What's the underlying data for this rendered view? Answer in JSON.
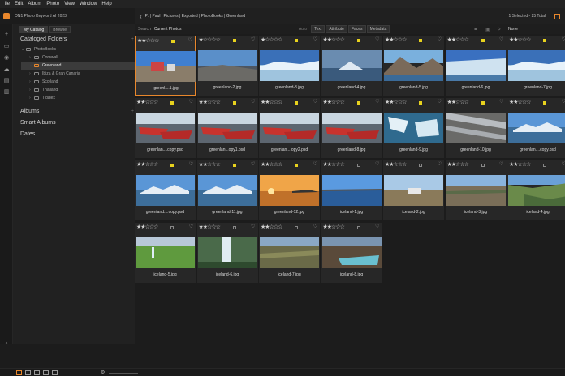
{
  "menu": [
    "ile",
    "Edit",
    "Album",
    "Photo",
    "View",
    "Window",
    "Help"
  ],
  "app_title": "ON1 Photo Keyword AI 2023",
  "sidebar": {
    "tabs": [
      "My Catalog",
      "Browse"
    ],
    "cataloged_folders": "Cataloged Folders",
    "tree": [
      {
        "label": "PhotoBooks",
        "level": 0,
        "open": true
      },
      {
        "label": "Cornwall",
        "level": 1
      },
      {
        "label": "Greenland",
        "level": 1,
        "selected": true,
        "open": true
      },
      {
        "label": "Ibiza & Gran Canaria",
        "level": 1
      },
      {
        "label": "Scotland",
        "level": 1
      },
      {
        "label": "Thailand",
        "level": 1
      },
      {
        "label": "Tidalex",
        "level": 1
      }
    ],
    "albums": "Albums",
    "smart_albums": "Smart Albums",
    "dates": "Dates"
  },
  "toolbar": {
    "breadcrumb": "P: | Paul | Pictures | Exported | PhotoBooks | Greenland",
    "status": "1 Selected - 25 Total"
  },
  "filter": {
    "search_label": "Search",
    "search_value": "Current Photos",
    "auto": "Auto",
    "tabs": [
      "Text",
      "Attribute",
      "Faces",
      "Metadata"
    ],
    "sort_value": "None"
  },
  "photos": [
    {
      "name": "greenl....1.jpg",
      "stars": 2,
      "flag": "yellow",
      "scene": "port",
      "selected": true
    },
    {
      "name": "greenland-2.jpg",
      "stars": 1,
      "flag": "yellow",
      "scene": "coast"
    },
    {
      "name": "greenland-3.jpg",
      "stars": 1,
      "flag": "yellow",
      "scene": "ice"
    },
    {
      "name": "greenland-4.jpg",
      "stars": 2,
      "flag": "yellow",
      "scene": "berg"
    },
    {
      "name": "greenland-5.jpg",
      "stars": 2,
      "flag": "yellow",
      "scene": "mount"
    },
    {
      "name": "greenland-6.jpg",
      "stars": 2,
      "flag": "yellow",
      "scene": "glacier"
    },
    {
      "name": "greenland-7.jpg",
      "stars": 2,
      "flag": "yellow",
      "scene": "ice"
    },
    {
      "name": "greenlan....copy.psd",
      "stars": 2,
      "flag": "yellow",
      "scene": "boats"
    },
    {
      "name": "greenlan...opy1.psd",
      "stars": 2,
      "flag": "yellow",
      "scene": "boats"
    },
    {
      "name": "greenlan....opy2.psd",
      "stars": 2,
      "flag": "yellow",
      "scene": "boats"
    },
    {
      "name": "greenland-8.jpg",
      "stars": 2,
      "flag": "yellow",
      "scene": "boats"
    },
    {
      "name": "greenland-9.jpg",
      "stars": 2,
      "flag": "yellow",
      "scene": "icefloe"
    },
    {
      "name": "greenland-10.jpg",
      "stars": 2,
      "flag": "yellow",
      "scene": "stripe"
    },
    {
      "name": "greenlan....copy.psd",
      "stars": 2,
      "flag": "yellow",
      "scene": "icesea"
    },
    {
      "name": "greenland....copy.psd",
      "stars": 2,
      "flag": "yellow",
      "scene": "icesea"
    },
    {
      "name": "greenland-11.jpg",
      "stars": 2,
      "flag": "yellow",
      "scene": "icesea"
    },
    {
      "name": "greenland-12.jpg",
      "stars": 2,
      "flag": "yellow",
      "scene": "sunset"
    },
    {
      "name": "iceland-1.jpg",
      "stars": 2,
      "flag": "none",
      "scene": "sea"
    },
    {
      "name": "iceland-2.jpg",
      "stars": 2,
      "flag": "none",
      "scene": "truck"
    },
    {
      "name": "iceland-3.jpg",
      "stars": 2,
      "flag": "none",
      "scene": "plain"
    },
    {
      "name": "iceland-4.jpg",
      "stars": 2,
      "flag": "none",
      "scene": "valley"
    },
    {
      "name": "iceland-5.jpg",
      "stars": 2,
      "flag": "none",
      "scene": "green"
    },
    {
      "name": "iceland-6.jpg",
      "stars": 2,
      "flag": "none",
      "scene": "falls"
    },
    {
      "name": "iceland-7.jpg",
      "stars": 2,
      "flag": "none",
      "scene": "moss"
    },
    {
      "name": "iceland-8.jpg",
      "stars": 2,
      "flag": "none",
      "scene": "lake"
    }
  ],
  "colors": {
    "accent": "#e8872c",
    "flag_yellow": "#e8d21e"
  }
}
